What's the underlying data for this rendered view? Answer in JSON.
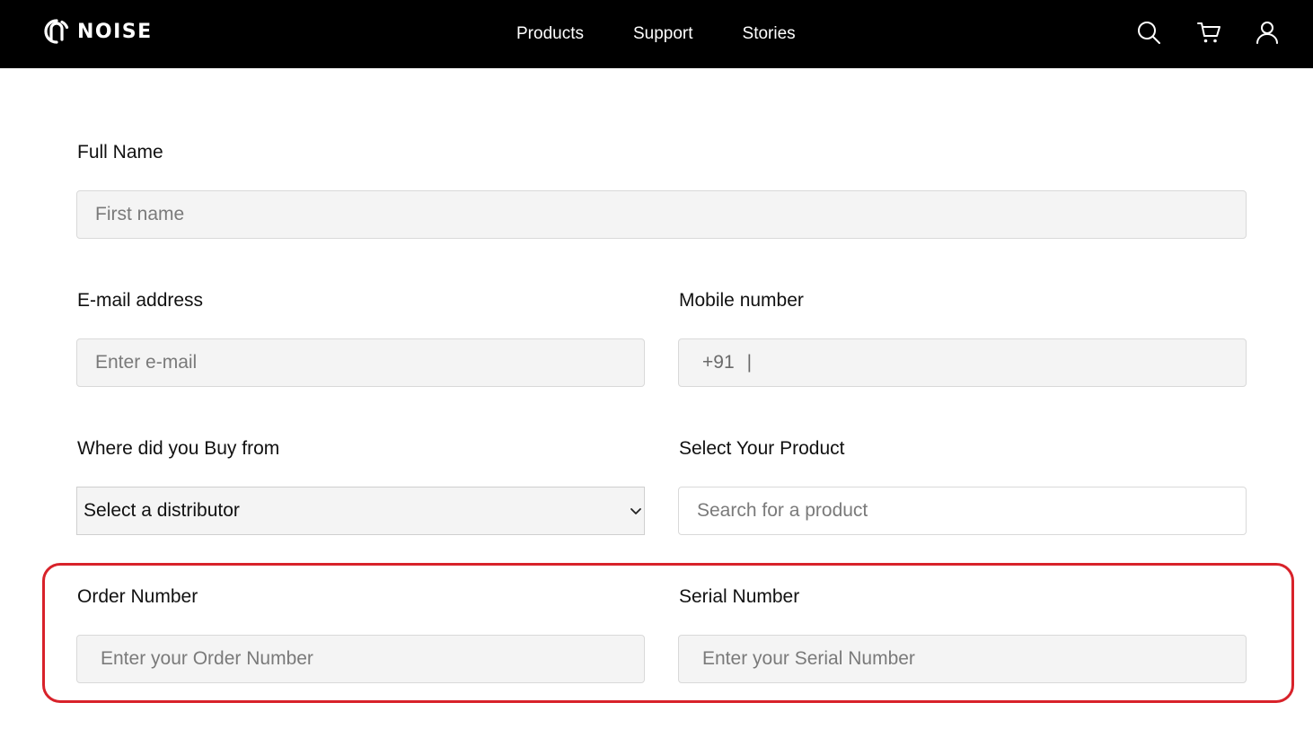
{
  "header": {
    "brand": "NOISE",
    "nav": [
      {
        "label": "Products"
      },
      {
        "label": "Support"
      },
      {
        "label": "Stories"
      }
    ],
    "icons": [
      "search-icon",
      "cart-icon",
      "user-icon"
    ],
    "background": "#000000",
    "text_color": "#ffffff"
  },
  "form": {
    "full_name": {
      "label": "Full Name",
      "placeholder": "First name"
    },
    "email": {
      "label": "E-mail address",
      "placeholder": "Enter e-mail"
    },
    "mobile": {
      "label": "Mobile number",
      "country_code": "+91",
      "separator": "|",
      "value": ""
    },
    "distributor": {
      "label": "Where did you Buy from",
      "selected": "Select a distributor"
    },
    "product": {
      "label": "Select Your Product",
      "placeholder": "Search for a product"
    },
    "order_number": {
      "label": "Order Number",
      "placeholder": "Enter your Order Number"
    },
    "serial_number": {
      "label": "Serial Number",
      "placeholder": "Enter your Serial Number"
    }
  },
  "highlight_color": "#d8222a"
}
